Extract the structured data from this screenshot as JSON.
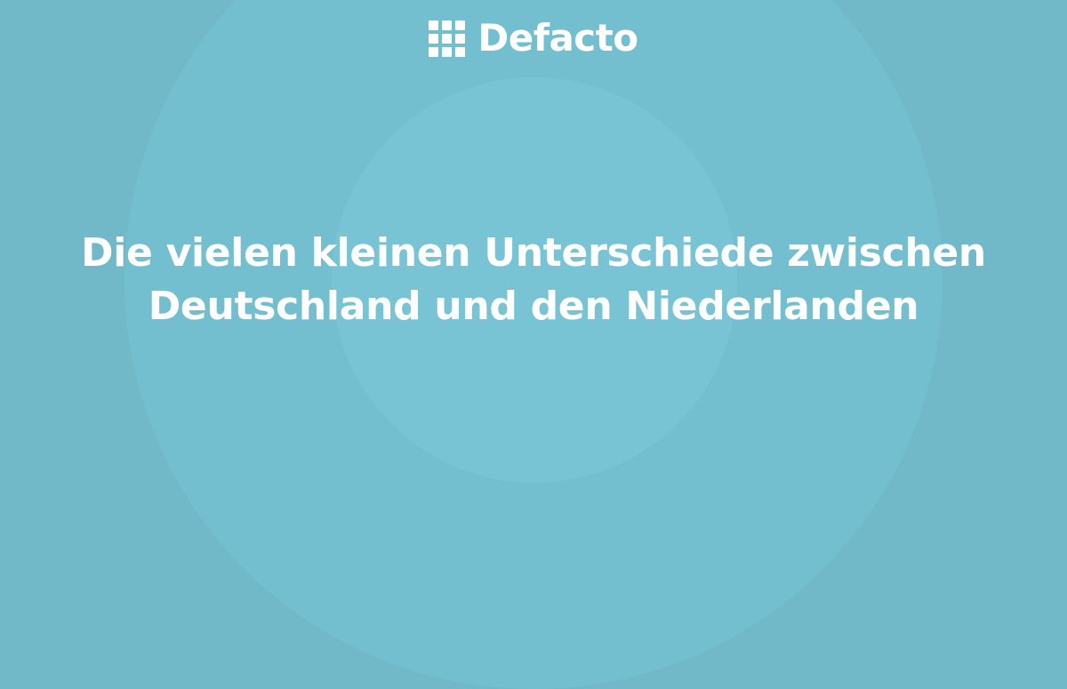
{
  "brand": {
    "name": "Defacto",
    "icon": "grid-logo-icon"
  },
  "headline": {
    "line1": "Die vielen kleinen Unterschiede zwischen",
    "line2": "Deutschland und den Niederlanden"
  },
  "colors": {
    "background": "#71b8c8",
    "circle_outer": "#74bfcf",
    "circle_inner": "#78c4d4",
    "text": "#ffffff"
  }
}
